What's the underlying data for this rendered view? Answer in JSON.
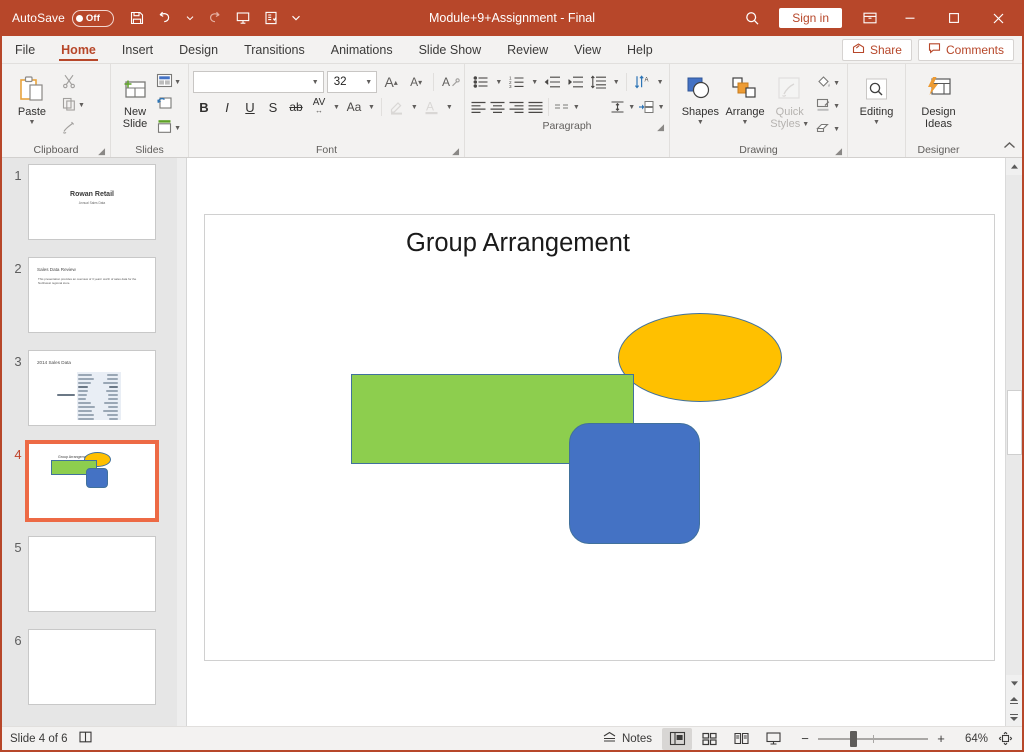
{
  "titlebar": {
    "autosave_label": "AutoSave",
    "autosave_state": "Off",
    "document_title": "Module+9+Assignment - Final",
    "signin_label": "Sign in",
    "quick_access": [
      {
        "name": "save-icon",
        "tooltip": "Save"
      },
      {
        "name": "undo-icon",
        "tooltip": "Undo"
      },
      {
        "name": "redo-icon",
        "tooltip": "Redo"
      },
      {
        "name": "start-presentation-icon",
        "tooltip": "Start From Beginning"
      },
      {
        "name": "customize-quick-access-icon",
        "tooltip": "Customize Quick Access Toolbar"
      }
    ],
    "window_buttons": [
      "minimize",
      "maximize",
      "close"
    ]
  },
  "tabs": {
    "items": [
      {
        "label": "File",
        "active": false
      },
      {
        "label": "Home",
        "active": true
      },
      {
        "label": "Insert",
        "active": false
      },
      {
        "label": "Design",
        "active": false
      },
      {
        "label": "Transitions",
        "active": false
      },
      {
        "label": "Animations",
        "active": false
      },
      {
        "label": "Slide Show",
        "active": false
      },
      {
        "label": "Review",
        "active": false
      },
      {
        "label": "View",
        "active": false
      },
      {
        "label": "Help",
        "active": false
      }
    ],
    "share_label": "Share",
    "comments_label": "Comments"
  },
  "ribbon": {
    "clipboard": {
      "group_label": "Clipboard",
      "paste_label": "Paste",
      "cut_label": "Cut",
      "copy_label": "Copy",
      "format_painter_label": "Format Painter"
    },
    "slides": {
      "group_label": "Slides",
      "new_slide_label": "New\nSlide",
      "new_slide_line1": "New",
      "new_slide_line2": "Slide",
      "layout_label": "Layout",
      "reset_label": "Reset",
      "section_label": "Section"
    },
    "font": {
      "group_label": "Font",
      "font_name_value": "",
      "font_name_placeholder": "",
      "font_size_value": "32",
      "increase_font_label": "A",
      "decrease_font_label": "A",
      "clear_formatting_label": "A",
      "bold_label": "B",
      "italic_label": "I",
      "underline_label": "U",
      "shadow_label": "S",
      "strikethrough_label": "ab",
      "character_spacing_label": "AV",
      "change_case_label": "Aa",
      "text_highlight_label": "Text Highlight Color",
      "font_color_label": "A"
    },
    "paragraph": {
      "group_label": "Paragraph",
      "bullets_label": "Bullets",
      "numbering_label": "Numbering",
      "decrease_indent_label": "Decrease List Level",
      "increase_indent_label": "Increase List Level",
      "line_spacing_label": "Line Spacing",
      "text_direction_label": "Text Direction",
      "align_text_label": "Align Text",
      "smartart_label": "Convert to SmartArt",
      "align_left_label": "Align Left",
      "center_label": "Center",
      "align_right_label": "Align Right",
      "justify_label": "Justify",
      "columns_label": "Columns"
    },
    "drawing": {
      "group_label": "Drawing",
      "shapes_label": "Shapes",
      "arrange_label": "Arrange",
      "quick_styles_line1": "Quick",
      "quick_styles_line2": "Styles",
      "quick_styles_disabled": true,
      "shape_fill_label": "Shape Fill",
      "shape_outline_label": "Shape Outline",
      "shape_effects_label": "Shape Effects"
    },
    "editing": {
      "group_label": "",
      "editing_label": "Editing"
    },
    "designer": {
      "group_label": "Designer",
      "design_ideas_line1": "Design",
      "design_ideas_line2": "Ideas"
    },
    "collapse_ribbon_icon": "chevron-up-icon"
  },
  "thumbnails": [
    {
      "number": "1",
      "selected": false,
      "title": "Rowan Retail",
      "subtitle": "Annual Sales Data",
      "kind": "title"
    },
    {
      "number": "2",
      "selected": false,
      "title": "Sales Data Review",
      "body": "This presentation provides an overview of 3 years' worth of sales data for the Northwest regional store.",
      "kind": "bullet"
    },
    {
      "number": "3",
      "selected": false,
      "title": "2014 Sales Data",
      "kind": "table"
    },
    {
      "number": "4",
      "selected": true,
      "title": "Group Arrangement",
      "kind": "shapes"
    },
    {
      "number": "5",
      "selected": false,
      "title": "",
      "kind": "blank"
    },
    {
      "number": "6",
      "selected": false,
      "title": "",
      "kind": "blank"
    }
  ],
  "slide": {
    "title_text": "Group Arrangement",
    "shapes": [
      {
        "name": "green-rectangle",
        "type": "rectangle",
        "fill": "#8DCE4E",
        "outline": "#41719C"
      },
      {
        "name": "orange-ellipse",
        "type": "ellipse",
        "fill": "#FFC000",
        "outline": "#41719C"
      },
      {
        "name": "blue-rounded-rectangle",
        "type": "rounded-rectangle",
        "fill": "#4472C4",
        "outline": "#41719C"
      }
    ]
  },
  "statusbar": {
    "slide_counter": "Slide 4 of 6",
    "accessibility_label": "Accessibility Checker",
    "notes_label": "Notes",
    "views": [
      {
        "name": "normal-view",
        "active": true
      },
      {
        "name": "slide-sorter-view",
        "active": false
      },
      {
        "name": "reading-view",
        "active": false
      },
      {
        "name": "slide-show-view",
        "active": false
      }
    ],
    "zoom_out_label": "−",
    "zoom_in_label": "+",
    "zoom_percent": "64%",
    "fit_slide_label": "Fit slide to current window"
  },
  "colors": {
    "brand": "#b7472a",
    "ribbon_bg": "#f3f2f1",
    "thumb_panel_bg": "#e6e6e6",
    "selection": "#ed6a45",
    "green": "#8DCE4E",
    "orange": "#FFC000",
    "blue": "#4472C4",
    "shape_outline": "#41719C"
  }
}
